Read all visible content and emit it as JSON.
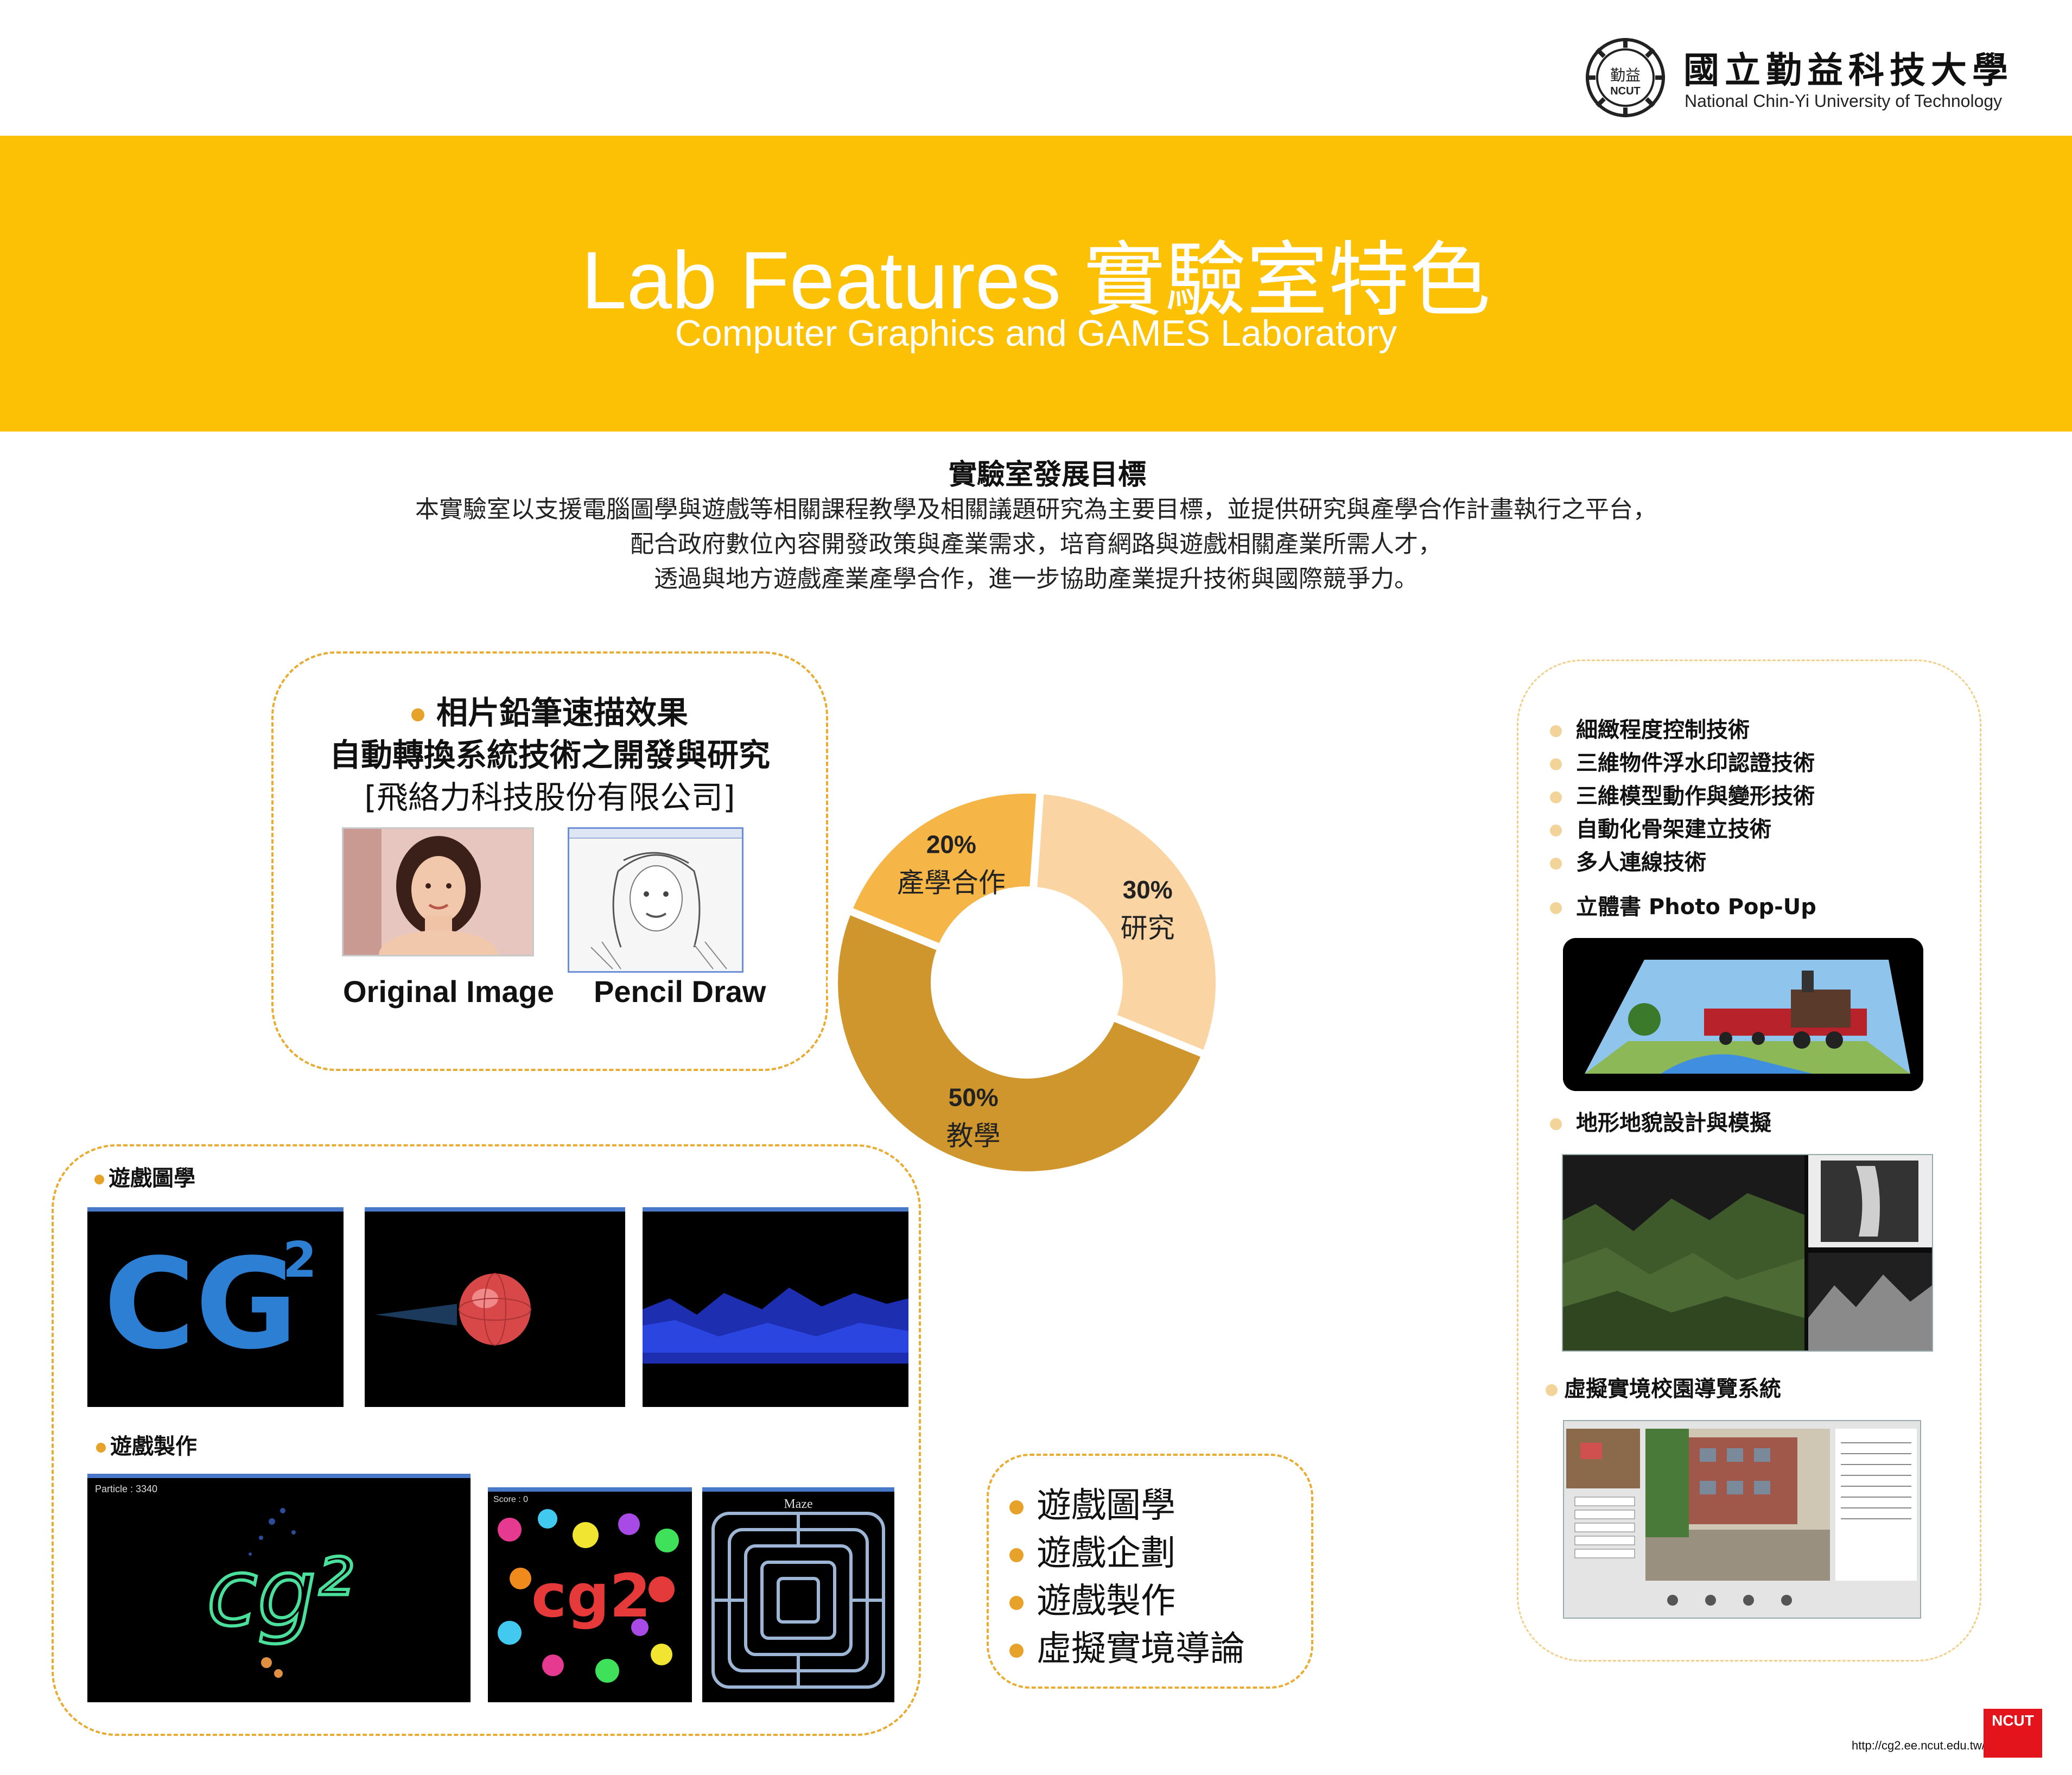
{
  "header": {
    "logo_cn": "國立勤益科技大學",
    "logo_en": "National Chin-Yi University of Technology",
    "seal_top": "勤益",
    "seal_bottom": "NCUT"
  },
  "banner": {
    "title": "Lab Features 實驗室特色",
    "subtitle": "Computer Graphics and GAMES Laboratory"
  },
  "goal": {
    "title": "實驗室發展目標",
    "lines": [
      "本實驗室以支援電腦圖學與遊戲等相關課程教學及相關議題研究為主要目標，並提供研究與產學合作計畫執行之平台，",
      "配合政府數位內容開發政策與產業需求，培育網路與遊戲相關產業所需人才，",
      "透過與地方遊戲產業產學合作，進一步協助產業提升技術與國際競爭力。"
    ]
  },
  "project": {
    "title_line1": "相片鉛筆速描效果",
    "title_line2": "自動轉換系統技術之開發與研究",
    "company": "[飛絡力科技股份有限公司]",
    "caption_original": "Original Image",
    "caption_pencil": "Pencil Draw"
  },
  "games": {
    "graphics_label": "遊戲圖學",
    "making_label": "遊戲製作",
    "shot_particle_text": "Particle : 3340",
    "shot_score_text": "Score : 0",
    "shot_maze_title": "Maze"
  },
  "courses": [
    "遊戲圖學",
    "遊戲企劃",
    "遊戲製作",
    "虛擬實境導論"
  ],
  "tech": {
    "items": [
      "細緻程度控制技術",
      "三維物件浮水印認證技術",
      "三維模型動作與變形技術",
      "自動化骨架建立技術",
      "多人連線技術"
    ],
    "popup_label": "立體書 Photo Pop-Up",
    "terrain_label": "地形地貌設計與模擬",
    "vr_label": "虛擬實境校園導覽系統"
  },
  "footer": {
    "url": "http://cg2.ee.ncut.edu.tw/",
    "badge": "NCUT"
  },
  "chart_data": {
    "type": "pie",
    "categories": [
      "研究",
      "教學",
      "產學合作"
    ],
    "values": [
      30,
      50,
      20
    ],
    "labels": [
      "30%",
      "50%",
      "20%"
    ],
    "colors": [
      "#fad5a3",
      "#d0962e",
      "#f5b547"
    ],
    "donut": true
  }
}
